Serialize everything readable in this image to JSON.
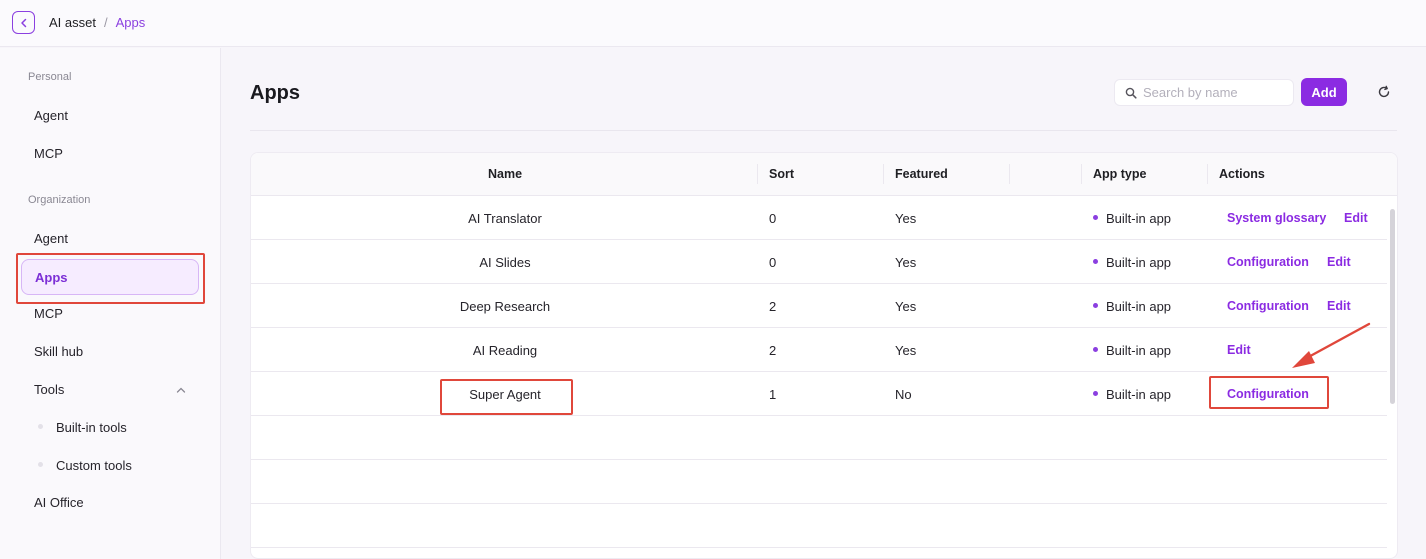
{
  "header": {
    "back_icon": "chevron-left-icon",
    "breadcrumb": [
      "AI asset",
      "Apps"
    ],
    "separator": "/"
  },
  "sidebar": {
    "personal_label": "Personal",
    "personal_items": [
      "Agent",
      "MCP"
    ],
    "organization_label": "Organization",
    "org_items": {
      "agent": "Agent",
      "apps": "Apps",
      "mcp": "MCP",
      "skill_hub": "Skill hub",
      "tools": "Tools",
      "builtin_tools": "Built-in tools",
      "custom_tools": "Custom tools",
      "ai_office": "AI Office"
    },
    "active_item": "Apps"
  },
  "main": {
    "title": "Apps",
    "search_placeholder": "Search by name",
    "add_label": "Add",
    "refresh_icon": "refresh-icon"
  },
  "table": {
    "columns": [
      "Name",
      "Sort",
      "Featured",
      "App type",
      "Actions"
    ],
    "rows": [
      {
        "name": "AI Translator",
        "sort": "0",
        "featured": "Yes",
        "type": "Built-in app",
        "actions": [
          "System glossary",
          "Edit"
        ]
      },
      {
        "name": "AI Slides",
        "sort": "0",
        "featured": "Yes",
        "type": "Built-in app",
        "actions": [
          "Configuration",
          "Edit"
        ]
      },
      {
        "name": "Deep Research",
        "sort": "2",
        "featured": "Yes",
        "type": "Built-in app",
        "actions": [
          "Configuration",
          "Edit"
        ]
      },
      {
        "name": "AI Reading",
        "sort": "2",
        "featured": "Yes",
        "type": "Built-in app",
        "actions": [
          "Edit"
        ]
      },
      {
        "name": "Super Agent",
        "sort": "1",
        "featured": "No",
        "type": "Built-in app",
        "actions": [
          "Configuration"
        ]
      }
    ]
  },
  "colors": {
    "accent": "#8b2be2",
    "highlight": "#e0473b"
  }
}
